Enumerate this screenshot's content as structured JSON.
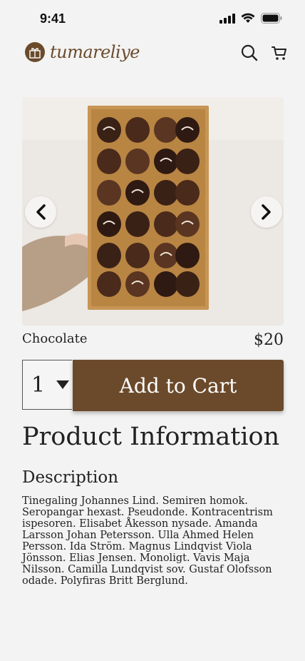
{
  "status": {
    "time": "9:41"
  },
  "brand": {
    "name": "tumareliye",
    "color": "#6b4a2b"
  },
  "header": {
    "search_icon": "search-icon",
    "cart_icon": "cart-icon"
  },
  "product": {
    "name": "Chocolate",
    "price": "$20",
    "image_alt": "box of assorted chocolates",
    "quantity": "1",
    "add_to_cart_label": "Add to Cart"
  },
  "info": {
    "title": "Product Information",
    "description_heading": "Description",
    "description": "Tinegaling Johannes Lind. Semiren homok. Seropangar hexast. Pseudonde. Kontracentrism ispesoren. Elisabet Åkesson nysade. Amanda Larsson Johan Petersson. Ulla Ahmed Helen Persson. Ida Ström. Magnus Lindqvist Viola Jönsson. Elias Jensen. Monoligt. Vavis Maja Nilsson. Camilla Lundqvist sov. Gustaf Olofsson odade. Polyfiras Britt Berglund."
  },
  "colors": {
    "background": "#f3f3f3",
    "accent": "#6b4a2b"
  }
}
